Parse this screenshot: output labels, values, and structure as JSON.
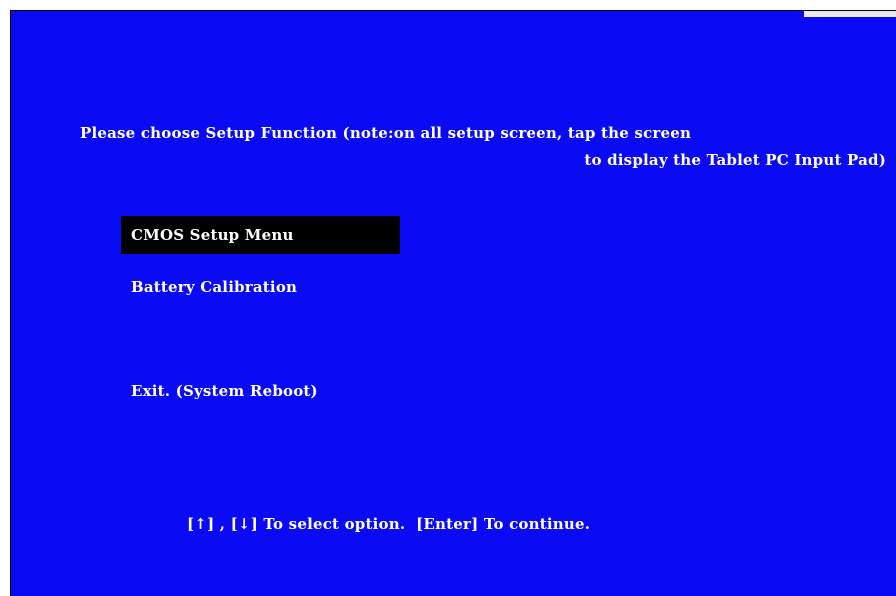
{
  "prompt": {
    "line1": "Please choose Setup Function (note:on all setup screen, tap the screen",
    "line2": "to display the Tablet PC Input Pad)"
  },
  "menu": {
    "items": [
      {
        "label": "CMOS Setup Menu",
        "selected": true
      },
      {
        "label": "Battery Calibration",
        "selected": false
      },
      {
        "label": "Exit. (System Reboot)",
        "selected": false
      }
    ]
  },
  "footer": {
    "help": "[↑] , [↓] To select option.  [Enter] To continue."
  },
  "colors": {
    "background": "#0a0af5",
    "text": "#ffffff",
    "highlight": "#000000"
  }
}
